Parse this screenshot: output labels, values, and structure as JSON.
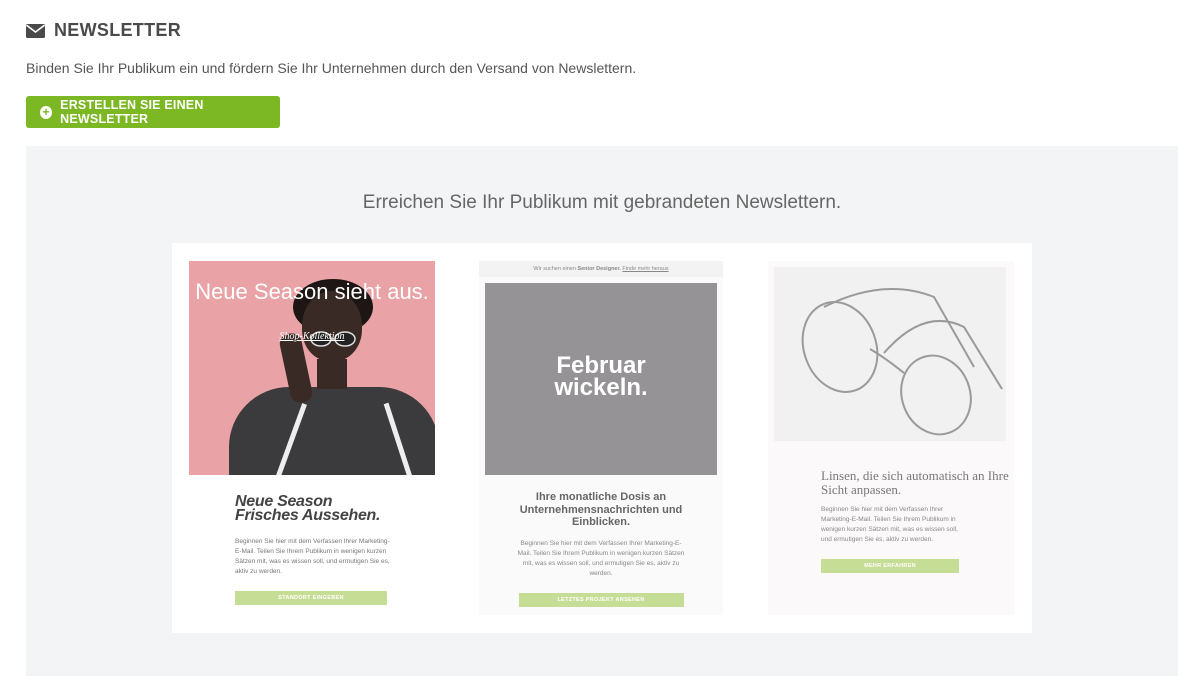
{
  "header": {
    "icon": "envelope-icon",
    "title": "NEWSLETTER"
  },
  "subtitle": "Binden Sie Ihr Publikum ein und fördern Sie Ihr Unternehmen durch den Versand von Newslettern.",
  "create_button": {
    "icon": "plus-circle-icon",
    "label": "ERSTELLEN SIE EINEN NEWSLETTER",
    "color": "#7cb724"
  },
  "promo": {
    "heading": "Erreichen Sie Ihr Publikum mit gebrandeten Newslettern.",
    "templates": [
      {
        "image_title": "Neue Season sieht aus.",
        "image_link": "Shop-Kollektion",
        "title_line1": "Neue Season",
        "title_line2": "Frisches Aussehen.",
        "text": "Beginnen Sie hier mit dem Verfassen Ihrer Marketing-E-Mail. Teilen Sie Ihrem Publikum in wenigen kurzen Sätzen mit, was es wissen soll, und ermutigen Sie es, aktiv zu werden.",
        "button": "STANDORT EINGEBEN"
      },
      {
        "banner_prefix": "Wir suchen einen",
        "banner_bold": "Senior Designer.",
        "banner_link": "Finde mehr heraus",
        "image_line1": "Februar",
        "image_line2": "wickeln.",
        "title": "Ihre monatliche Dosis an Unternehmensnachrichten und Einblicken.",
        "text": "Beginnen Sie hier mit dem Verfassen Ihrer Marketing-E-Mail. Teilen Sie Ihrem Publikum in wenigen kurzen Sätzen mit, was es wissen soll, und ermutigen Sie es, aktiv zu werden.",
        "button": "LETZTES PROJEKT ANSEHEN"
      },
      {
        "title": "Linsen, die sich automatisch an Ihre Sicht anpassen.",
        "text": "Beginnen Sie hier mit dem Verfassen Ihrer Marketing-E-Mail. Teilen Sie Ihrem Publikum in wenigen kurzen Sätzen mit, was es wissen soll, und ermutigen Sie es, aktiv zu werden.",
        "button": "MEHR ERFAHREN"
      }
    ]
  }
}
